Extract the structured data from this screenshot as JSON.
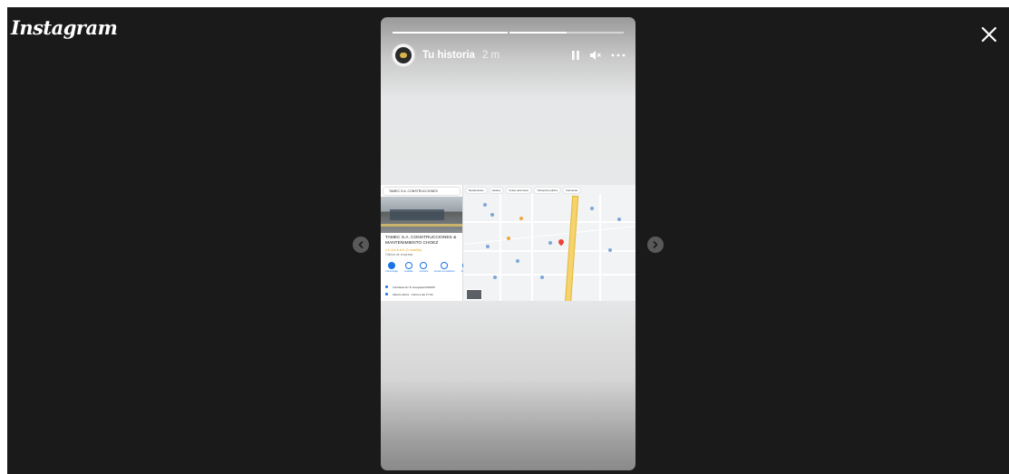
{
  "app": {
    "logo": "Instagram",
    "close_icon": "close-icon"
  },
  "story": {
    "username": "Tu historia",
    "time": "2 m",
    "progress": [
      {
        "fill": 1.0
      },
      {
        "fill": 0.5
      }
    ],
    "controls": {
      "pause_icon": "pause-icon",
      "mute_icon": "volume-muted-icon",
      "more_icon": "more-options-icon"
    }
  },
  "screenshot": {
    "search_text": "TAMEC S.A. CONSTRUCCIONES",
    "place_title": "TAMEC S.A. CONSTRUCCIONES & MANTENIMIENTO CHOEZ",
    "rating": "4,6 ★★★★★ (3 reseñas)",
    "category": "Oficina de empresa",
    "actions": [
      "Cómo llegar",
      "Guardar",
      "Cercano",
      "Enviar a tu teléfono",
      "Compartir"
    ],
    "address": "Vía Daule km 8, Guayaquil 090109",
    "hours": "Abierto ahora · Cierra a las 17:00",
    "map_chips": [
      "Restaurantes",
      "Hoteles",
      "Cosas para hacer",
      "Transporte público",
      "Farmacias"
    ]
  },
  "colors": {
    "viewer_bg": "#1a1a1a",
    "accent_blue": "#1a73e8",
    "marker_red": "#ea4335",
    "highway_yellow": "#f6d36c"
  }
}
